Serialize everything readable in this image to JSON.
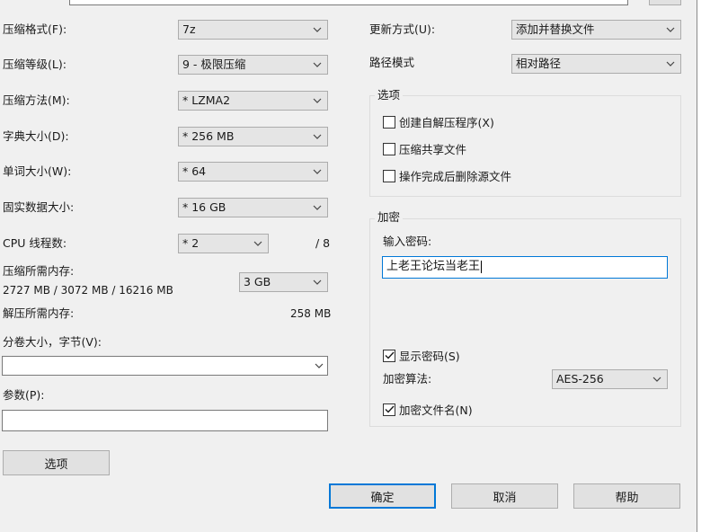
{
  "left": {
    "format_label": "压缩格式(F):",
    "format_value": "7z",
    "level_label": "压缩等级(L):",
    "level_value": "9 - 极限压缩",
    "method_label": "压缩方法(M):",
    "method_value": "* LZMA2",
    "dict_label": "字典大小(D):",
    "dict_value": "* 256 MB",
    "word_label": "单词大小(W):",
    "word_value": "* 64",
    "solid_label": "固实数据大小:",
    "solid_value": "* 16 GB",
    "threads_label": "CPU 线程数:",
    "threads_value": "* 2",
    "threads_max": "/ 8",
    "mem_comp_label": "压缩所需内存:",
    "mem_comp_detail": "2727 MB / 3072 MB / 16216 MB",
    "mem_comp_value": "3 GB",
    "mem_decomp_label": "解压所需内存:",
    "mem_decomp_value": "258 MB",
    "volume_label": "分卷大小，字节(V):",
    "volume_value": "",
    "params_label": "参数(P):",
    "params_value": "",
    "options_button": "选项"
  },
  "right": {
    "update_label": "更新方式(U):",
    "update_value": "添加并替换文件",
    "path_label": "路径模式",
    "path_value": "相对路径",
    "options_group": "选项",
    "opt_sfx": "创建自解压程序(X)",
    "opt_shared": "压缩共享文件",
    "opt_delete": "操作完成后删除源文件",
    "encrypt_group": "加密",
    "password_label": "输入密码:",
    "password_value": "上老王论坛当老王",
    "show_password": "显示密码(S)",
    "enc_method_label": "加密算法:",
    "enc_method_value": "AES-256",
    "encrypt_names": "加密文件名(N)"
  },
  "buttons": {
    "ok": "确定",
    "cancel": "取消",
    "help": "帮助"
  },
  "checkbox_state": {
    "sfx": false,
    "shared": false,
    "delete": false,
    "show_password": true,
    "encrypt_names": true
  },
  "colors": {
    "dialog_bg": "#f0f0f0",
    "accent": "#0078d7"
  }
}
